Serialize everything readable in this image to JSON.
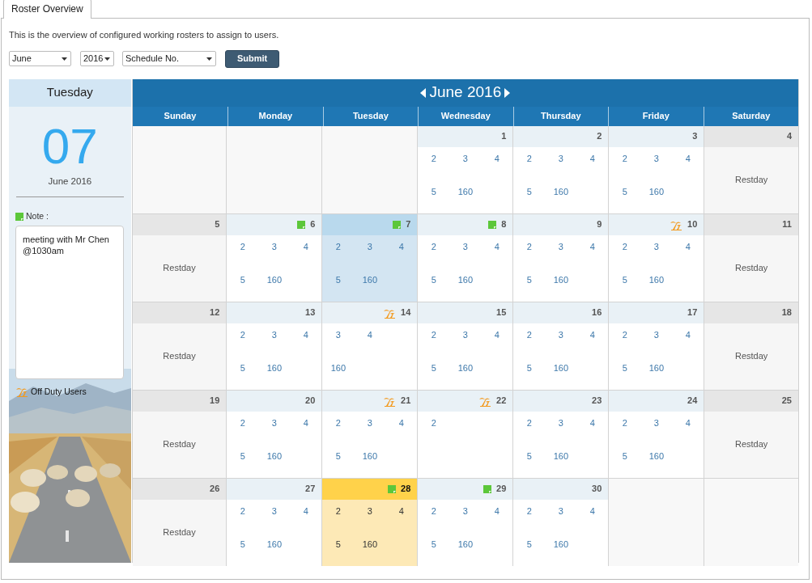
{
  "tab": {
    "label": "Roster Overview",
    "selected": true
  },
  "description": "This is the overview of configured working rosters to assign to users.",
  "filters": {
    "month": "June",
    "year": "2016",
    "schedule": "Schedule No.",
    "submit": "Submit"
  },
  "side_panel": {
    "weekday": "Tuesday",
    "day": "07",
    "month_year": "June 2016",
    "note_label": "Note :",
    "note": "meeting with Mr Chen @1030am",
    "off_duty_label": "Off Duty Users"
  },
  "calendar": {
    "title": "June 2016",
    "weekdays": [
      "Sunday",
      "Monday",
      "Tuesday",
      "Wednesday",
      "Thursday",
      "Friday",
      "Saturday"
    ],
    "weeks": [
      {
        "days": [
          {
            "kind": "blank"
          },
          {
            "kind": "blank"
          },
          {
            "kind": "blank"
          },
          {
            "kind": "work",
            "day": "1",
            "note": false,
            "off_duty": false,
            "selected": false,
            "today": false,
            "codes": [
              [
                "2",
                "3",
                "4"
              ],
              [
                "5",
                "160"
              ]
            ]
          },
          {
            "kind": "work",
            "day": "2",
            "note": false,
            "off_duty": false,
            "selected": false,
            "today": false,
            "codes": [
              [
                "2",
                "3",
                "4"
              ],
              [
                "5",
                "160"
              ]
            ]
          },
          {
            "kind": "work",
            "day": "3",
            "note": false,
            "off_duty": false,
            "selected": false,
            "today": false,
            "codes": [
              [
                "2",
                "3",
                "4"
              ],
              [
                "5",
                "160"
              ]
            ]
          },
          {
            "kind": "rest",
            "day": "4",
            "label": "Restday",
            "selected": false
          }
        ]
      },
      {
        "days": [
          {
            "kind": "rest",
            "day": "5",
            "label": "Restday",
            "selected": false
          },
          {
            "kind": "work",
            "day": "6",
            "note": true,
            "off_duty": false,
            "selected": false,
            "today": false,
            "codes": [
              [
                "2",
                "3",
                "4"
              ],
              [
                "5",
                "160"
              ]
            ]
          },
          {
            "kind": "work",
            "day": "7",
            "note": true,
            "off_duty": false,
            "selected": true,
            "today": false,
            "codes": [
              [
                "2",
                "3",
                "4"
              ],
              [
                "5",
                "160"
              ]
            ]
          },
          {
            "kind": "work",
            "day": "8",
            "note": true,
            "off_duty": false,
            "selected": false,
            "today": false,
            "codes": [
              [
                "2",
                "3",
                "4"
              ],
              [
                "5",
                "160"
              ]
            ]
          },
          {
            "kind": "work",
            "day": "9",
            "note": false,
            "off_duty": false,
            "selected": false,
            "today": false,
            "codes": [
              [
                "2",
                "3",
                "4"
              ],
              [
                "5",
                "160"
              ]
            ]
          },
          {
            "kind": "work",
            "day": "10",
            "note": false,
            "off_duty": true,
            "selected": false,
            "today": false,
            "codes": [
              [
                "2",
                "3",
                "4"
              ],
              [
                "5",
                "160"
              ]
            ]
          },
          {
            "kind": "rest",
            "day": "11",
            "label": "Restday",
            "selected": false
          }
        ]
      },
      {
        "days": [
          {
            "kind": "rest",
            "day": "12",
            "label": "Restday",
            "selected": false
          },
          {
            "kind": "work",
            "day": "13",
            "note": false,
            "off_duty": false,
            "selected": false,
            "today": false,
            "codes": [
              [
                "2",
                "3",
                "4"
              ],
              [
                "5",
                "160"
              ]
            ]
          },
          {
            "kind": "work",
            "day": "14",
            "note": false,
            "off_duty": true,
            "selected": false,
            "today": false,
            "codes": [
              [
                "3",
                "4"
              ],
              [
                "160"
              ]
            ]
          },
          {
            "kind": "work",
            "day": "15",
            "note": false,
            "off_duty": false,
            "selected": false,
            "today": false,
            "codes": [
              [
                "2",
                "3",
                "4"
              ],
              [
                "5",
                "160"
              ]
            ]
          },
          {
            "kind": "work",
            "day": "16",
            "note": false,
            "off_duty": false,
            "selected": false,
            "today": false,
            "codes": [
              [
                "2",
                "3",
                "4"
              ],
              [
                "5",
                "160"
              ]
            ]
          },
          {
            "kind": "work",
            "day": "17",
            "note": false,
            "off_duty": false,
            "selected": false,
            "today": false,
            "codes": [
              [
                "2",
                "3",
                "4"
              ],
              [
                "5",
                "160"
              ]
            ]
          },
          {
            "kind": "rest",
            "day": "18",
            "label": "Restday",
            "selected": false
          }
        ]
      },
      {
        "days": [
          {
            "kind": "rest",
            "day": "19",
            "label": "Restday",
            "selected": false
          },
          {
            "kind": "work",
            "day": "20",
            "note": false,
            "off_duty": false,
            "selected": false,
            "today": false,
            "codes": [
              [
                "2",
                "3",
                "4"
              ],
              [
                "5",
                "160"
              ]
            ]
          },
          {
            "kind": "work",
            "day": "21",
            "note": false,
            "off_duty": true,
            "selected": false,
            "today": false,
            "codes": [
              [
                "2",
                "3",
                "4"
              ],
              [
                "5",
                "160"
              ]
            ]
          },
          {
            "kind": "work",
            "day": "22",
            "note": false,
            "off_duty": true,
            "selected": false,
            "today": false,
            "codes": [
              [
                "2"
              ]
            ]
          },
          {
            "kind": "work",
            "day": "23",
            "note": false,
            "off_duty": false,
            "selected": false,
            "today": false,
            "codes": [
              [
                "2",
                "3",
                "4"
              ],
              [
                "5",
                "160"
              ]
            ]
          },
          {
            "kind": "work",
            "day": "24",
            "note": false,
            "off_duty": false,
            "selected": false,
            "today": false,
            "codes": [
              [
                "2",
                "3",
                "4"
              ],
              [
                "5",
                "160"
              ]
            ]
          },
          {
            "kind": "rest",
            "day": "25",
            "label": "Restday",
            "selected": false
          }
        ]
      },
      {
        "days": [
          {
            "kind": "rest",
            "day": "26",
            "label": "Restday",
            "selected": false
          },
          {
            "kind": "work",
            "day": "27",
            "note": false,
            "off_duty": false,
            "selected": false,
            "today": false,
            "codes": [
              [
                "2",
                "3",
                "4"
              ],
              [
                "5",
                "160"
              ]
            ]
          },
          {
            "kind": "work",
            "day": "28",
            "note": true,
            "off_duty": false,
            "selected": false,
            "today": true,
            "codes": [
              [
                "2",
                "3",
                "4"
              ],
              [
                "5",
                "160"
              ]
            ]
          },
          {
            "kind": "work",
            "day": "29",
            "note": true,
            "off_duty": false,
            "selected": false,
            "today": false,
            "codes": [
              [
                "2",
                "3",
                "4"
              ],
              [
                "5",
                "160"
              ]
            ]
          },
          {
            "kind": "work",
            "day": "30",
            "note": false,
            "off_duty": false,
            "selected": false,
            "today": false,
            "codes": [
              [
                "2",
                "3",
                "4"
              ],
              [
                "5",
                "160"
              ]
            ]
          },
          {
            "kind": "blank"
          },
          {
            "kind": "blank"
          }
        ]
      }
    ]
  }
}
